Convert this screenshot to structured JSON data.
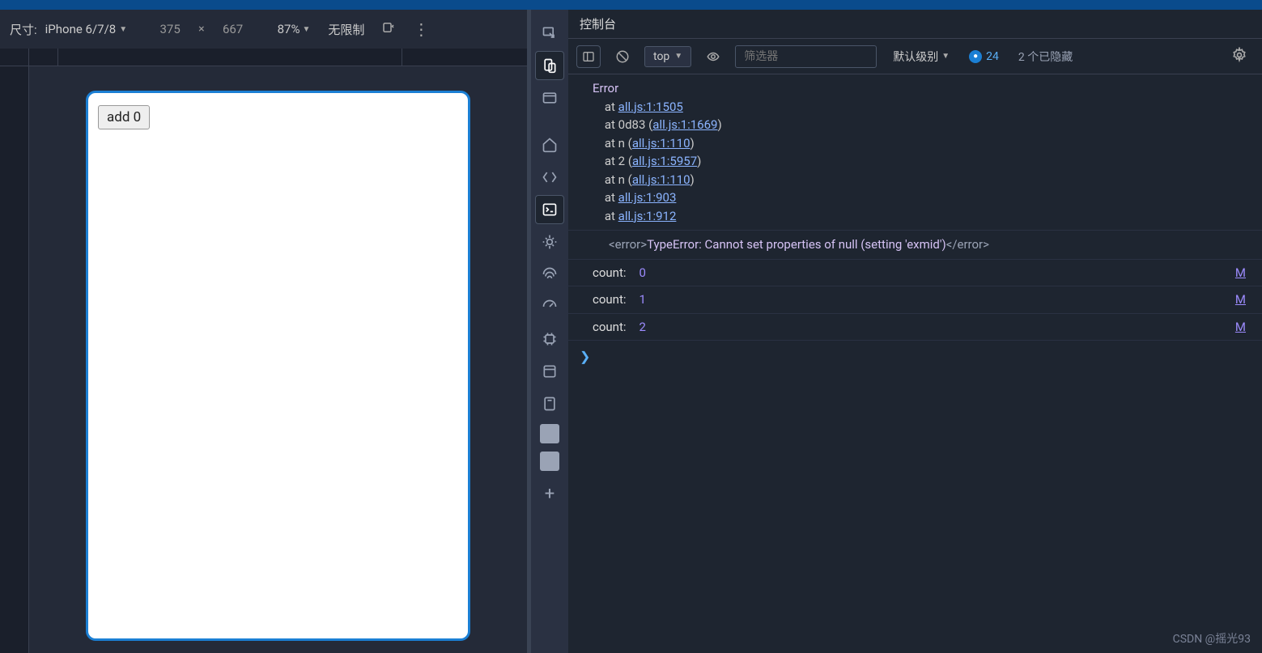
{
  "deviceToolbar": {
    "sizeLabel": "尺寸:",
    "deviceName": "iPhone 6/7/8",
    "width": "375",
    "height": "667",
    "zoom": "87%",
    "throttle": "无限制"
  },
  "phone": {
    "buttonLabel": "add 0"
  },
  "console": {
    "title": "控制台",
    "context": "top",
    "filterPlaceholder": "筛选器",
    "level": "默认级别",
    "issueCount": "24",
    "hiddenText": "2 个已隐藏"
  },
  "error": {
    "title": "Error",
    "stack": [
      {
        "prefix": "    at ",
        "mid": "",
        "link": "all.js:1:1505",
        "suffix": ""
      },
      {
        "prefix": "    at 0d83 (",
        "mid": "",
        "link": "all.js:1:1669",
        "suffix": ")"
      },
      {
        "prefix": "    at n (",
        "mid": "",
        "link": "all.js:1:110",
        "suffix": ")"
      },
      {
        "prefix": "    at 2 (",
        "mid": "",
        "link": "all.js:1:5957",
        "suffix": ")"
      },
      {
        "prefix": "    at n (",
        "mid": "",
        "link": "all.js:1:110",
        "suffix": ")"
      },
      {
        "prefix": "    at ",
        "mid": "",
        "link": "all.js:1:903",
        "suffix": ""
      },
      {
        "prefix": "    at ",
        "mid": "",
        "link": "all.js:1:912",
        "suffix": ""
      }
    ],
    "taggedOpen": "<error>",
    "taggedMsg": "TypeError: Cannot set properties of null (setting 'exmid')",
    "taggedClose": "</error>"
  },
  "logs": [
    {
      "label": "count:",
      "value": "0",
      "src": "M"
    },
    {
      "label": "count:",
      "value": "1",
      "src": "M"
    },
    {
      "label": "count:",
      "value": "2",
      "src": "M"
    }
  ],
  "prompt": "❯",
  "watermark": "CSDN @摇光93"
}
